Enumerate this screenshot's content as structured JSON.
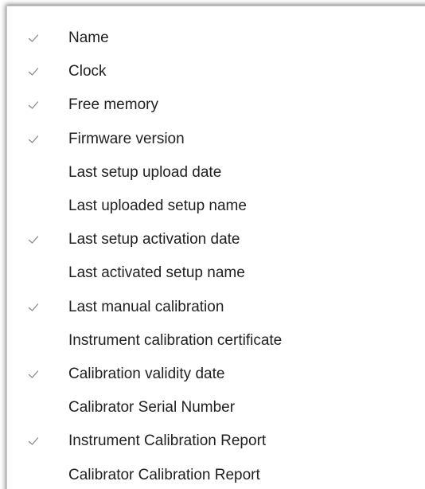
{
  "menu": {
    "items": [
      {
        "label": "Name",
        "checked": true
      },
      {
        "label": "Clock",
        "checked": true
      },
      {
        "label": "Free memory",
        "checked": true
      },
      {
        "label": "Firmware version",
        "checked": true
      },
      {
        "label": "Last setup upload date",
        "checked": false
      },
      {
        "label": "Last uploaded setup name",
        "checked": false
      },
      {
        "label": "Last setup activation date",
        "checked": true
      },
      {
        "label": "Last activated setup name",
        "checked": false
      },
      {
        "label": "Last manual calibration",
        "checked": true
      },
      {
        "label": "Instrument calibration certificate",
        "checked": false
      },
      {
        "label": "Calibration validity date",
        "checked": true
      },
      {
        "label": "Calibrator Serial Number",
        "checked": false
      },
      {
        "label": "Instrument Calibration Report",
        "checked": true
      },
      {
        "label": "Calibrator Calibration Report",
        "checked": false
      }
    ],
    "check_icon": "checkmark-icon",
    "check_color": "#8a8a8a",
    "text_color": "#1f1f1f"
  }
}
